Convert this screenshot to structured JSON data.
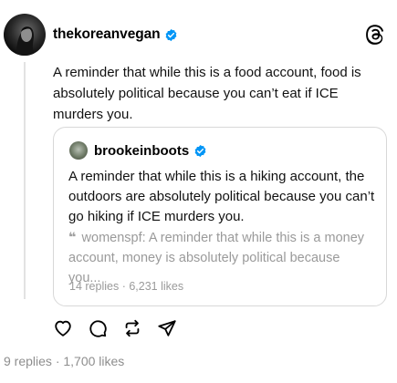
{
  "post": {
    "author": "thekoreanvegan",
    "text": "A reminder that while this is a food account, food is absolutely political because you can’t eat if ICE murders you.",
    "stats": {
      "replies": "9 replies",
      "separator": "·",
      "likes": "1,700 likes"
    }
  },
  "quoted": {
    "author": "brookeinboots",
    "text": "A reminder that while this is a hiking account, the outdoors are absolutely political because you can’t go hiking if ICE murders you.",
    "nested_quote": {
      "mark": "❝",
      "text": "womenspf: A reminder that while this is a money account, money is absolutely political because you..."
    },
    "stats": {
      "replies": "14 replies",
      "separator": "·",
      "likes": "6,231 likes"
    }
  },
  "icons": {
    "brand": "threads-logo-icon",
    "verified": "verified-badge-icon",
    "actions": [
      "heart-icon",
      "comment-icon",
      "repost-icon",
      "share-icon"
    ]
  },
  "colors": {
    "verified_blue": "#0095f6",
    "muted_text": "#9a9a9a",
    "border": "#d8d8d8"
  }
}
